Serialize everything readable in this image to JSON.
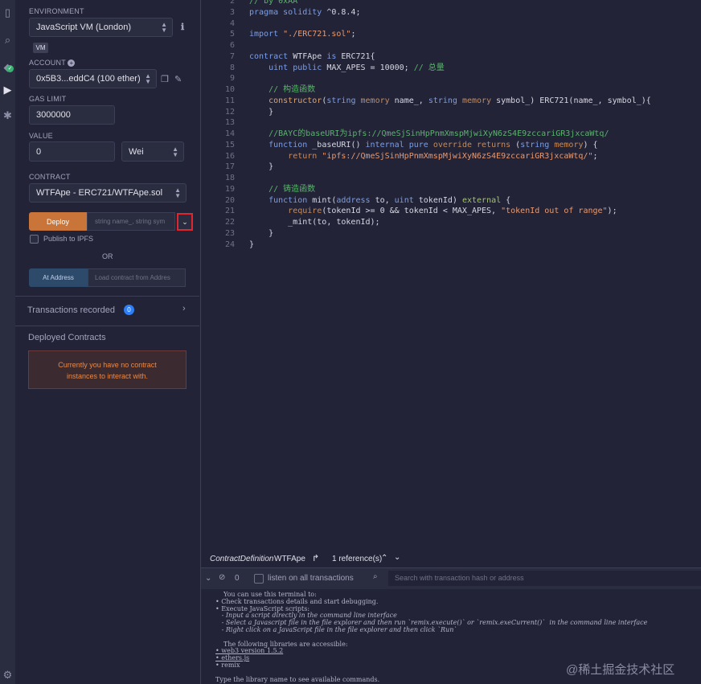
{
  "sidebar_panel": {
    "environment_label": "ENVIRONMENT",
    "environment_value": "JavaScript VM (London)",
    "vm_badge": "VM",
    "account_label": "ACCOUNT",
    "account_value": "0x5B3...eddC4 (100 ether)",
    "gas_limit_label": "GAS LIMIT",
    "gas_limit_value": "3000000",
    "value_label": "VALUE",
    "value_amount": "0",
    "value_unit": "Wei",
    "contract_label": "CONTRACT",
    "contract_value": "WTFApe - ERC721/WTFApe.sol",
    "deploy_button": "Deploy",
    "deploy_params_placeholder": "string name_, string sym",
    "publish_ipfs": "Publish to IPFS",
    "or_text": "OR",
    "at_address_button": "At Address",
    "load_contract_placeholder": "Load contract from Addres",
    "transactions_recorded": "Transactions recorded",
    "transactions_count": "0",
    "deployed_contracts": "Deployed Contracts",
    "no_contracts_line1": "Currently you have no contract",
    "no_contracts_line2": "instances to interact with."
  },
  "editor": {
    "lines": [
      {
        "n": "2",
        "parts": [
          [
            "c",
            "// by 0xAA"
          ]
        ]
      },
      {
        "n": "3",
        "parts": [
          [
            "k",
            "pragma solidity"
          ],
          [
            "f",
            " ^0.8.4;"
          ]
        ]
      },
      {
        "n": "4",
        "parts": []
      },
      {
        "n": "5",
        "parts": [
          [
            "k",
            "import"
          ],
          [
            "f",
            " "
          ],
          [
            "s",
            "\"./ERC721.sol\""
          ],
          [
            "f",
            ";"
          ]
        ]
      },
      {
        "n": "6",
        "parts": []
      },
      {
        "n": "7",
        "parts": [
          [
            "k",
            "contract"
          ],
          [
            "f",
            " WTFApe "
          ],
          [
            "k",
            "is"
          ],
          [
            "f",
            " ERC721{"
          ]
        ]
      },
      {
        "n": "8",
        "parts": [
          [
            "f",
            "    "
          ],
          [
            "k",
            "uint public"
          ],
          [
            "f",
            " MAX_APES = 10000; "
          ],
          [
            "c",
            "// 总量"
          ]
        ]
      },
      {
        "n": "9",
        "parts": []
      },
      {
        "n": "10",
        "parts": [
          [
            "f",
            "    "
          ],
          [
            "c",
            "// 构造函数"
          ]
        ]
      },
      {
        "n": "11",
        "parts": [
          [
            "f",
            "    "
          ],
          [
            "o",
            "constructor"
          ],
          [
            "f",
            "("
          ],
          [
            "k",
            "string"
          ],
          [
            "f",
            " "
          ],
          [
            "t",
            "memory"
          ],
          [
            "f",
            " name_, "
          ],
          [
            "k",
            "string"
          ],
          [
            "f",
            " "
          ],
          [
            "t",
            "memory"
          ],
          [
            "f",
            " symbol_) ERC721(name_, symbol_){"
          ]
        ]
      },
      {
        "n": "12",
        "parts": [
          [
            "f",
            "    }"
          ]
        ]
      },
      {
        "n": "13",
        "parts": []
      },
      {
        "n": "14",
        "parts": [
          [
            "f",
            "    "
          ],
          [
            "c",
            "//BAYC的baseURI为ipfs://QmeSjSinHpPnmXmspMjwiXyN6zS4E9zccariGR3jxcaWtq/"
          ]
        ]
      },
      {
        "n": "15",
        "parts": [
          [
            "f",
            "    "
          ],
          [
            "k",
            "function"
          ],
          [
            "f",
            " _baseURI() "
          ],
          [
            "k",
            "internal pure"
          ],
          [
            "f",
            " "
          ],
          [
            "t",
            "override returns"
          ],
          [
            "f",
            " ("
          ],
          [
            "k",
            "string"
          ],
          [
            "f",
            " "
          ],
          [
            "t",
            "memory"
          ],
          [
            "f",
            ") {"
          ]
        ]
      },
      {
        "n": "16",
        "parts": [
          [
            "f",
            "        "
          ],
          [
            "t",
            "return"
          ],
          [
            "f",
            " "
          ],
          [
            "s",
            "\"ipfs://QmeSjSinHpPnmXmspMjwiXyN6zS4E9zccariGR3jxcaWtq/\""
          ],
          [
            "f",
            ";"
          ]
        ]
      },
      {
        "n": "17",
        "parts": [
          [
            "f",
            "    }"
          ]
        ]
      },
      {
        "n": "18",
        "parts": []
      },
      {
        "n": "19",
        "parts": [
          [
            "f",
            "    "
          ],
          [
            "c",
            "// 铸造函数"
          ]
        ]
      },
      {
        "n": "20",
        "parts": [
          [
            "f",
            "    "
          ],
          [
            "k",
            "function"
          ],
          [
            "f",
            " mint("
          ],
          [
            "k",
            "address"
          ],
          [
            "f",
            " to, "
          ],
          [
            "k",
            "uint"
          ],
          [
            "f",
            " tokenId) "
          ],
          [
            "g",
            "external"
          ],
          [
            "f",
            " {"
          ]
        ]
      },
      {
        "n": "21",
        "parts": [
          [
            "f",
            "        "
          ],
          [
            "t",
            "require"
          ],
          [
            "f",
            "(tokenId >= 0 && tokenId < MAX_APES, "
          ],
          [
            "s",
            "\"tokenId out of range\""
          ],
          [
            "f",
            ");"
          ]
        ]
      },
      {
        "n": "22",
        "parts": [
          [
            "f",
            "        _mint(to, tokenId);"
          ]
        ]
      },
      {
        "n": "23",
        "parts": [
          [
            "f",
            "    }"
          ]
        ]
      },
      {
        "n": "24",
        "parts": [
          [
            "f",
            "}"
          ]
        ]
      }
    ]
  },
  "reference_bar": {
    "definition_kind": "ContractDefinition",
    "definition_name": "WTFApe",
    "references": "1 reference(s)"
  },
  "terminal_bar": {
    "count": "0",
    "listen_label": "listen on all transactions",
    "search_placeholder": "Search with transaction hash or address"
  },
  "terminal": {
    "lines": [
      "You can use this terminal to:",
      "• Check transactions details and start debugging.",
      "• Execute JavaScript scripts:",
      "   - Input a script directly in the command line interface",
      "   - Select a Javascript file in the file explorer and then run `remix.execute()` or `remix.exeCurrent()`  in the command line interface",
      "   - Right click on a JavaScript file in the file explorer and then click `Run`",
      "",
      "The following libraries are accessible:",
      "• web3 version 1.5.2",
      "• ethers.js",
      "• remix",
      "",
      "Type the library name to see available commands."
    ]
  },
  "watermark": "@稀土掘金技术社区",
  "colors": {
    "background": "#222336",
    "deploy_orange": "#c97539",
    "at_address_blue": "#2e4a6b",
    "alert_red_bg": "#3b2a30",
    "alert_text": "#e88a4a",
    "badge_blue": "#2d7ff9"
  }
}
